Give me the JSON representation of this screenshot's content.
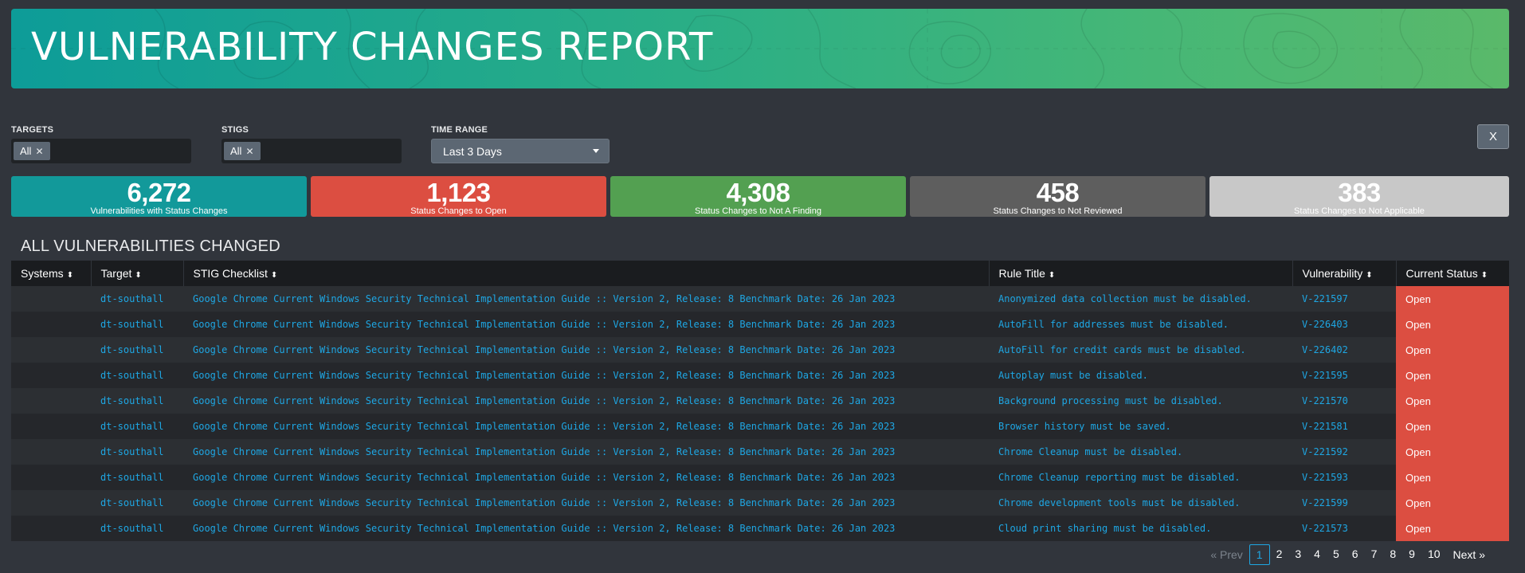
{
  "header": {
    "title": "VULNERABILITY CHANGES REPORT"
  },
  "filters": {
    "targets": {
      "label": "TARGETS",
      "tag": "All"
    },
    "stigs": {
      "label": "STIGS",
      "tag": "All"
    },
    "time_range": {
      "label": "TIME RANGE",
      "value": "Last 3 Days"
    },
    "close_label": "X"
  },
  "kpis": [
    {
      "value": "6,272",
      "label": "Vulnerabilities with Status Changes",
      "color": "#12999a"
    },
    {
      "value": "1,123",
      "label": "Status Changes to Open",
      "color": "#dc4e41"
    },
    {
      "value": "4,308",
      "label": "Status Changes to Not A Finding",
      "color": "#53a051"
    },
    {
      "value": "458",
      "label": "Status Changes to Not Reviewed",
      "color": "#5e5e5e"
    },
    {
      "value": "383",
      "label": "Status Changes to Not Applicable",
      "color": "#c8c8c8"
    }
  ],
  "section": {
    "title": "ALL VULNERABILITIES CHANGED"
  },
  "table": {
    "columns": [
      "Systems",
      "Target",
      "STIG Checklist",
      "Rule Title",
      "Vulnerability",
      "Current Status"
    ],
    "rows": [
      {
        "systems": "",
        "target": "dt-southall",
        "stig": "Google Chrome Current Windows Security Technical Implementation Guide :: Version 2, Release: 8 Benchmark Date: 26 Jan 2023",
        "rule": "Anonymized data collection must be disabled.",
        "vuln": "V-221597",
        "status": "Open"
      },
      {
        "systems": "",
        "target": "dt-southall",
        "stig": "Google Chrome Current Windows Security Technical Implementation Guide :: Version 2, Release: 8 Benchmark Date: 26 Jan 2023",
        "rule": "AutoFill for addresses must be disabled.",
        "vuln": "V-226403",
        "status": "Open"
      },
      {
        "systems": "",
        "target": "dt-southall",
        "stig": "Google Chrome Current Windows Security Technical Implementation Guide :: Version 2, Release: 8 Benchmark Date: 26 Jan 2023",
        "rule": "AutoFill for credit cards must be disabled.",
        "vuln": "V-226402",
        "status": "Open"
      },
      {
        "systems": "",
        "target": "dt-southall",
        "stig": "Google Chrome Current Windows Security Technical Implementation Guide :: Version 2, Release: 8 Benchmark Date: 26 Jan 2023",
        "rule": "Autoplay must be disabled.",
        "vuln": "V-221595",
        "status": "Open"
      },
      {
        "systems": "",
        "target": "dt-southall",
        "stig": "Google Chrome Current Windows Security Technical Implementation Guide :: Version 2, Release: 8 Benchmark Date: 26 Jan 2023",
        "rule": "Background processing must be disabled.",
        "vuln": "V-221570",
        "status": "Open"
      },
      {
        "systems": "",
        "target": "dt-southall",
        "stig": "Google Chrome Current Windows Security Technical Implementation Guide :: Version 2, Release: 8 Benchmark Date: 26 Jan 2023",
        "rule": "Browser history must be saved.",
        "vuln": "V-221581",
        "status": "Open"
      },
      {
        "systems": "",
        "target": "dt-southall",
        "stig": "Google Chrome Current Windows Security Technical Implementation Guide :: Version 2, Release: 8 Benchmark Date: 26 Jan 2023",
        "rule": "Chrome Cleanup must be disabled.",
        "vuln": "V-221592",
        "status": "Open"
      },
      {
        "systems": "",
        "target": "dt-southall",
        "stig": "Google Chrome Current Windows Security Technical Implementation Guide :: Version 2, Release: 8 Benchmark Date: 26 Jan 2023",
        "rule": "Chrome Cleanup reporting must be disabled.",
        "vuln": "V-221593",
        "status": "Open"
      },
      {
        "systems": "",
        "target": "dt-southall",
        "stig": "Google Chrome Current Windows Security Technical Implementation Guide :: Version 2, Release: 8 Benchmark Date: 26 Jan 2023",
        "rule": "Chrome development tools must be disabled.",
        "vuln": "V-221599",
        "status": "Open"
      },
      {
        "systems": "",
        "target": "dt-southall",
        "stig": "Google Chrome Current Windows Security Technical Implementation Guide :: Version 2, Release: 8 Benchmark Date: 26 Jan 2023",
        "rule": "Cloud print sharing must be disabled.",
        "vuln": "V-221573",
        "status": "Open"
      }
    ]
  },
  "pagination": {
    "prev": "« Prev",
    "pages": [
      "1",
      "2",
      "3",
      "4",
      "5",
      "6",
      "7",
      "8",
      "9",
      "10"
    ],
    "active": "1",
    "next": "Next »"
  },
  "icons": {
    "sort": "sort-icon",
    "remove": "close-icon",
    "dropdown": "caret-down-icon"
  }
}
